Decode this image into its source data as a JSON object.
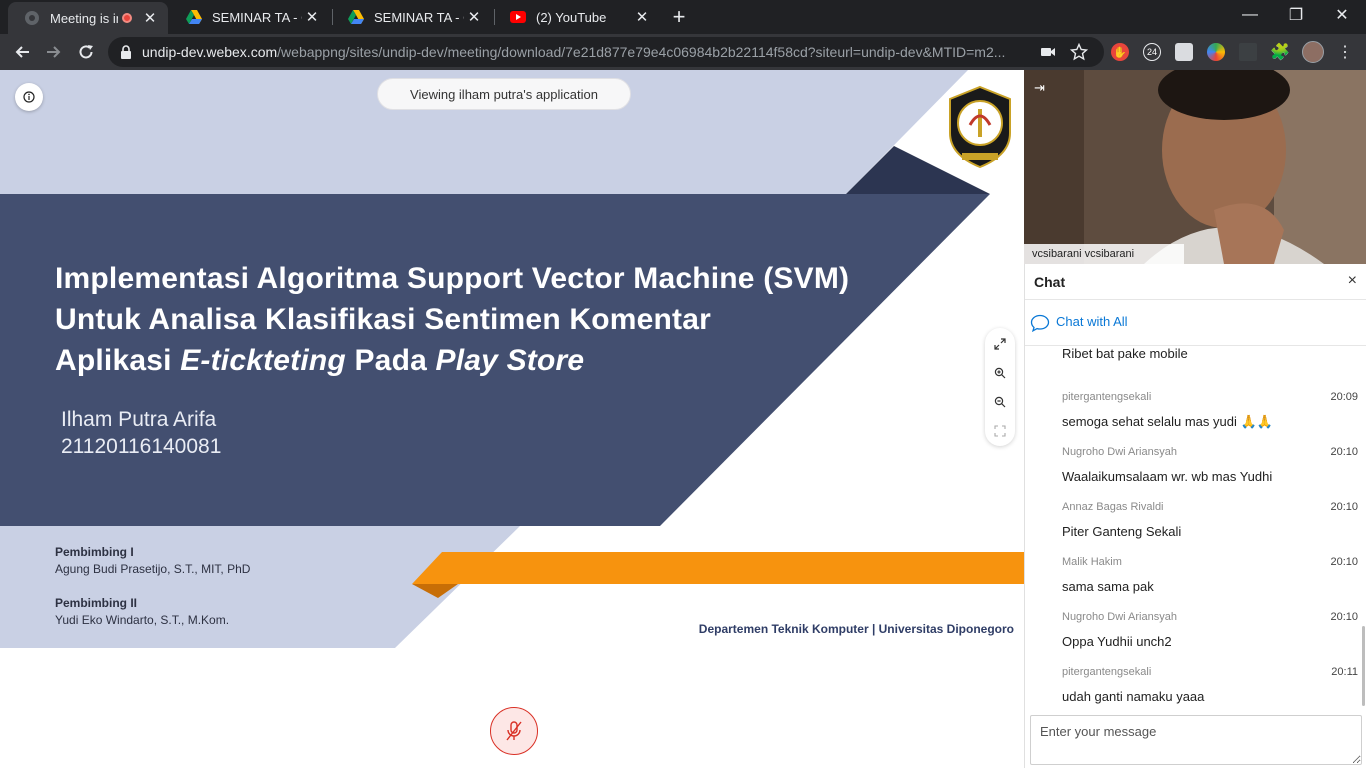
{
  "tabs": [
    {
      "title": "Meeting is in p",
      "favicon": "webex-icon",
      "recording": true
    },
    {
      "title": "SEMINAR TA - Goo",
      "favicon": "google-drive-icon"
    },
    {
      "title": "SEMINAR TA - Goo",
      "favicon": "google-drive-icon"
    },
    {
      "title": "(2) YouTube",
      "favicon": "youtube-icon"
    }
  ],
  "new_tab_label": "+",
  "window": {
    "minimize": "—",
    "restore": "❐",
    "close": "✕"
  },
  "address_bar": {
    "host": "undip-dev.webex.com",
    "path": "/webappng/sites/undip-dev/meeting/download/7e21d877e79e4c06984b2b22114f58cd?siteurl=undip-dev&MTID=m2..."
  },
  "extensions": {
    "badge_24": "24"
  },
  "presentation": {
    "viewing_label": "Viewing ilham putra's application",
    "title": {
      "line1": "Implementasi Algoritma Support Vector Machine (SVM)",
      "line2": "Untuk Analisa Klasifikasi Sentimen Komentar",
      "line3_pre": "Aplikasi ",
      "line3_em1": "E-tickteting",
      "line3_mid": " Pada ",
      "line3_em2": "Play Store"
    },
    "author_name": "Ilham Putra Arifa",
    "author_id": "21120116140081",
    "supervisor1_heading": "Pembimbing I",
    "supervisor1_name": "Agung Budi Prasetijo, S.T., MIT, PhD",
    "supervisor2_heading": "Pembimbing II",
    "supervisor2_name": "Yudi Eko Windarto, S.T., M.Kom.",
    "department": "Departemen Teknik Komputer | Universitas Diponegoro",
    "logo_text_top": "UNIVERSITAS DIPONEGORO",
    "logo_text_bottom": "SEMARANG"
  },
  "video": {
    "participant_name": "vcsibarani vcsibarani"
  },
  "chat": {
    "title": "Chat",
    "close": "×",
    "recipient": "Chat with All",
    "input_placeholder": "Enter your message",
    "messages": [
      {
        "sender": "",
        "time": "",
        "text": "Ribet bat pake mobile"
      },
      {
        "sender": "pitergantengsekali",
        "time": "20:09",
        "text": "semoga sehat selalu mas yudi 🙏🙏"
      },
      {
        "sender": "Nugroho Dwi Ariansyah",
        "time": "20:10",
        "text": "Waalaikumsalaam wr. wb mas Yudhi"
      },
      {
        "sender": "Annaz Bagas Rivaldi",
        "time": "20:10",
        "text": "Piter Ganteng Sekali"
      },
      {
        "sender": "Malik Hakim",
        "time": "20:10",
        "text": "sama sama pak"
      },
      {
        "sender": "Nugroho Dwi Ariansyah",
        "time": "20:10",
        "text": "Oppa Yudhii unch2"
      },
      {
        "sender": "pitergantengsekali",
        "time": "20:11",
        "text": "udah ganti namaku yaaa"
      }
    ]
  },
  "colors": {
    "slide_navy": "#434f70",
    "slide_light": "#c9d0e4",
    "slide_orange": "#f7930e",
    "chat_accent": "#0a78d6",
    "mute_red": "#d93025"
  }
}
